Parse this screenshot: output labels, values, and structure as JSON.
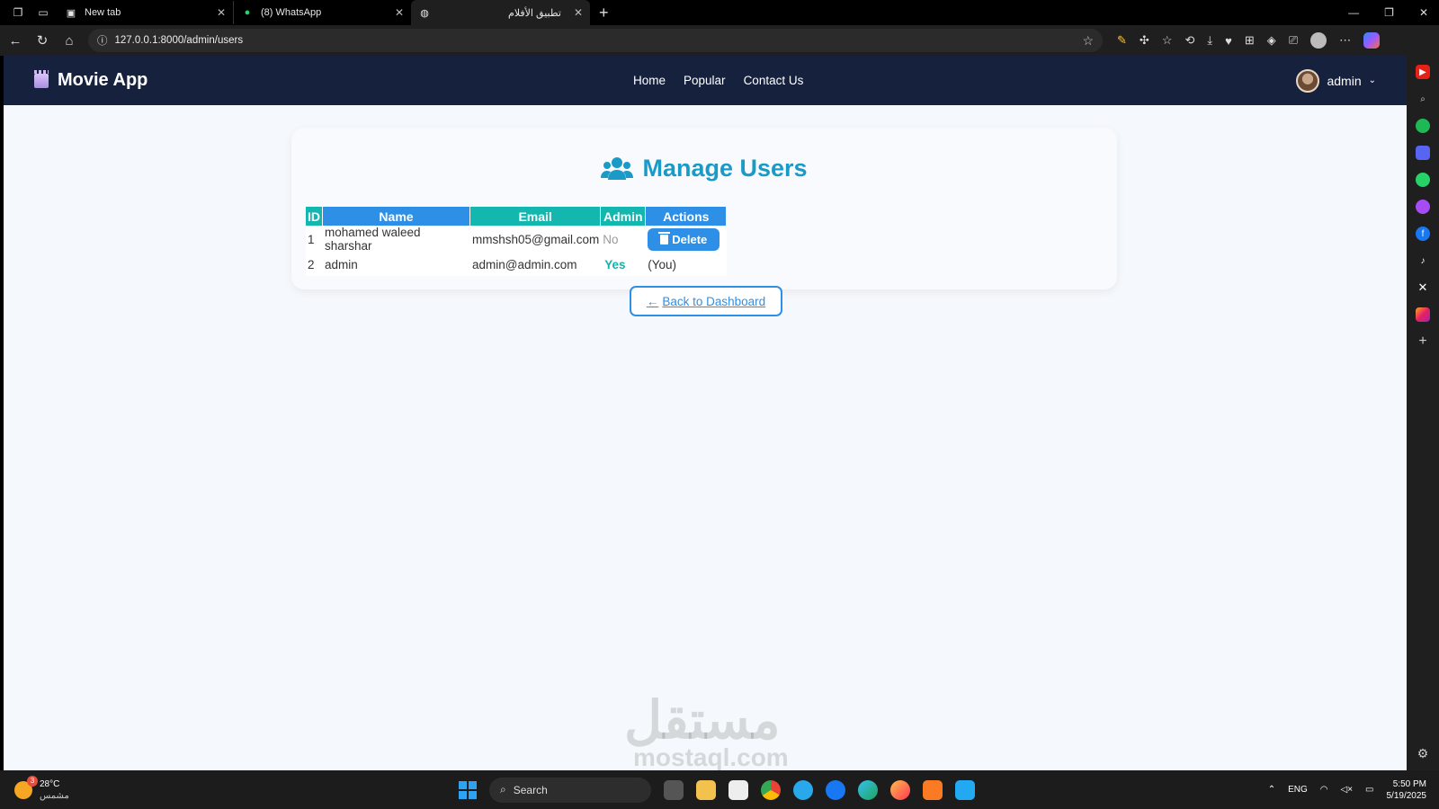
{
  "browser": {
    "tabs": [
      {
        "label": "New tab"
      },
      {
        "label": "(8) WhatsApp"
      },
      {
        "label": "تطبيق الأفلام"
      }
    ],
    "url": "127.0.0.1:8000/admin/users"
  },
  "navbar": {
    "brand": "Movie App",
    "links": [
      "Home",
      "Popular",
      "Contact Us"
    ],
    "user": "admin"
  },
  "page": {
    "title": "Manage Users",
    "table": {
      "headers": [
        "ID",
        "Name",
        "Email",
        "Admin",
        "Actions"
      ],
      "rows": [
        {
          "id": "1",
          "name": "mohamed waleed sharshar",
          "email": "mmshsh05@gmail.com",
          "admin": "No",
          "action": "Delete"
        },
        {
          "id": "2",
          "name": "admin",
          "email": "admin@admin.com",
          "admin": "Yes",
          "action": "(You)"
        }
      ]
    },
    "back_button": "Back to Dashboard"
  },
  "watermark": {
    "arabic": "مستقل",
    "latin": "mostaql.com"
  },
  "taskbar": {
    "temperature": "28°C",
    "weather_text": "مشمس",
    "weather_badge": "3",
    "search_placeholder": "Search",
    "language": "ENG",
    "time": "5:50 PM",
    "date": "5/19/2025"
  }
}
